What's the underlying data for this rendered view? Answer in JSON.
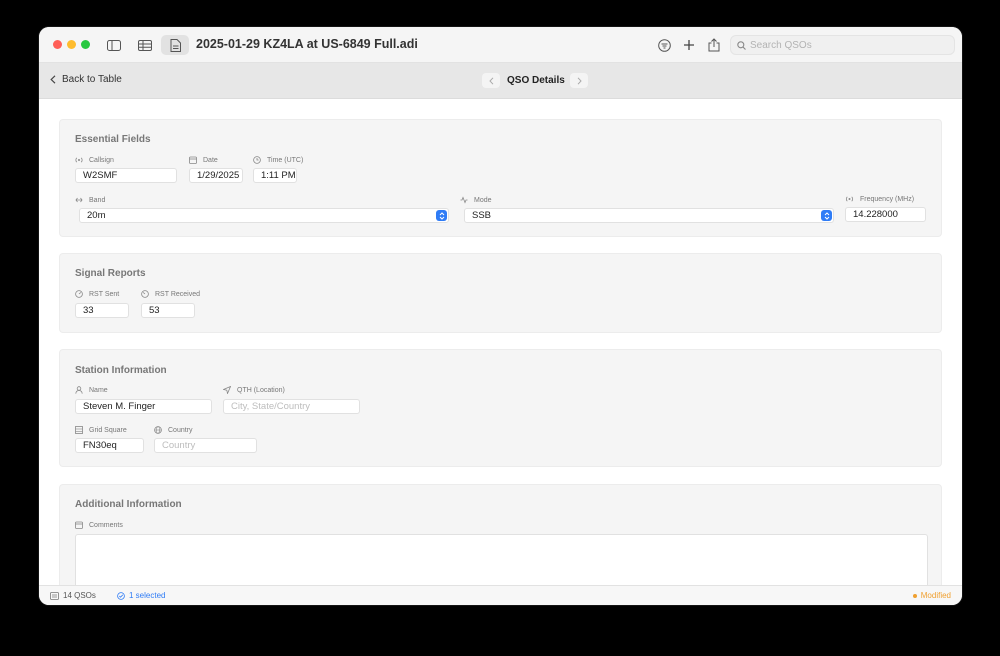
{
  "window": {
    "title": "2025-01-29 KZ4LA at US-6849 Full.adi",
    "search_placeholder": "Search QSOs"
  },
  "nav": {
    "back_label": "Back to Table",
    "title": "QSO Details"
  },
  "sections": {
    "essential": {
      "title": "Essential Fields",
      "callsign_label": "Callsign",
      "callsign_value": "W2SMF",
      "date_label": "Date",
      "date_value": "1/29/2025",
      "time_label": "Time (UTC)",
      "time_value": "1:11 PM",
      "band_label": "Band",
      "band_value": "20m",
      "mode_label": "Mode",
      "mode_value": "SSB",
      "frequency_label": "Frequency (MHz)",
      "frequency_value": "14.228000"
    },
    "signal": {
      "title": "Signal Reports",
      "rst_sent_label": "RST Sent",
      "rst_sent_value": "33",
      "rst_received_label": "RST Received",
      "rst_received_value": "53"
    },
    "station": {
      "title": "Station Information",
      "name_label": "Name",
      "name_value": "Steven M. Finger",
      "qth_label": "QTH (Location)",
      "qth_placeholder": "City, State/Country",
      "grid_label": "Grid Square",
      "grid_value": "FN30eq",
      "country_label": "Country",
      "country_placeholder": "Country"
    },
    "additional": {
      "title": "Additional Information",
      "comments_label": "Comments",
      "comments_value": ""
    }
  },
  "status": {
    "count": "14 QSOs",
    "selected": "1 selected",
    "modified": "Modified"
  },
  "colors": {
    "accent": "#2f7cf6",
    "modified": "#f0a030",
    "selected_text": "#2f7cf6"
  }
}
